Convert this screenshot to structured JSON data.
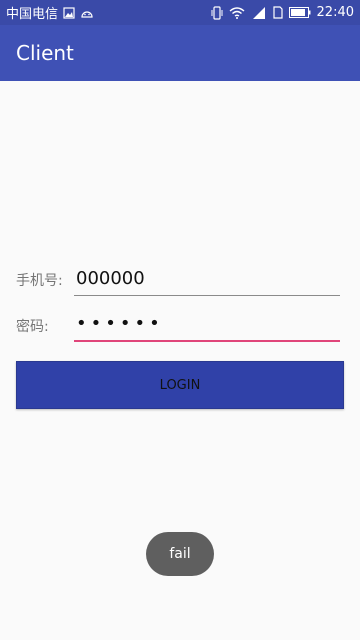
{
  "status_bar": {
    "carrier": "中国电信",
    "time": "22:40",
    "icons": [
      "image-icon",
      "android-icon",
      "vibrate-icon",
      "wifi-icon",
      "signal-4g-icon",
      "sim-icon",
      "battery-icon"
    ]
  },
  "app_bar": {
    "title": "Client"
  },
  "form": {
    "phone_label": "手机号:",
    "phone_value": "000000",
    "password_label": "密码:",
    "password_value": "••••••",
    "login_label": "LOGIN"
  },
  "toast": {
    "text": "fail"
  },
  "colors": {
    "primary": "#3f51b5",
    "primary_dark": "#3a4aa8",
    "accent": "#e0457a",
    "button": "#3041a8",
    "toast_bg": "#5f5f5f"
  }
}
